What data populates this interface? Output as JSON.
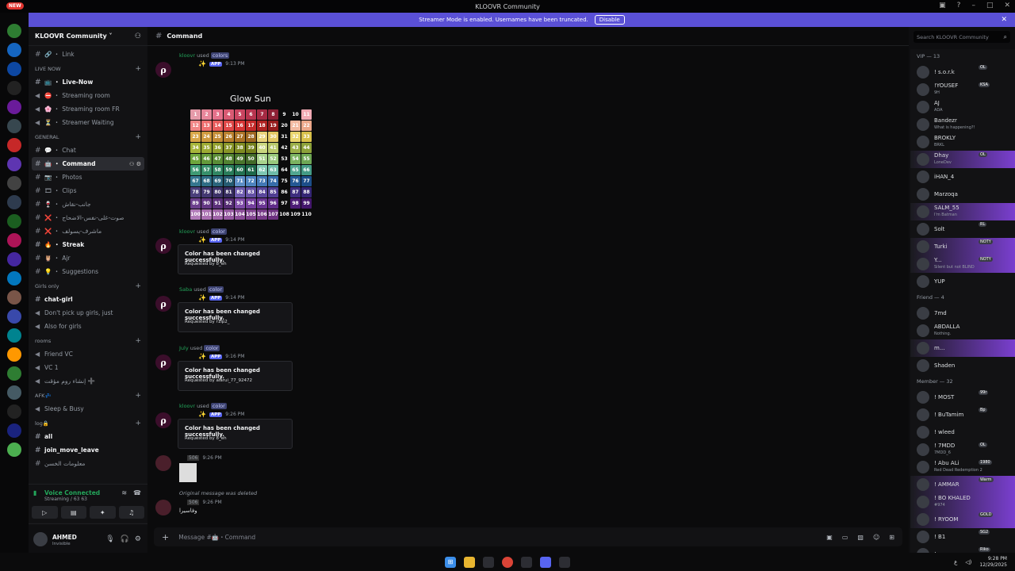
{
  "window": {
    "title": "KLOOVR Community",
    "new_badge": "NEW"
  },
  "banner": {
    "text": "Streamer Mode is enabled. Usernames have been truncated.",
    "button": "Disable"
  },
  "server": {
    "name": "KLOOVR Community"
  },
  "channels": [
    {
      "type": "ch",
      "icon": "🔗",
      "label": "Link"
    },
    {
      "type": "cat",
      "label": "LIVE NOW"
    },
    {
      "type": "ch",
      "icon": "📺",
      "label": "Live-Now",
      "bold": true
    },
    {
      "type": "voice",
      "icon": "⛔",
      "label": "Streaming room"
    },
    {
      "type": "voice",
      "icon": "🌸",
      "label": "Streaming room FR"
    },
    {
      "type": "voice",
      "icon": "⏳",
      "label": "Streamer Waiting"
    },
    {
      "type": "cat",
      "label": "GENERAL"
    },
    {
      "type": "ch",
      "icon": "💬",
      "label": "Chat"
    },
    {
      "type": "ch",
      "icon": "🤖",
      "label": "Command",
      "active": true
    },
    {
      "type": "ch",
      "icon": "📷",
      "label": "Photos"
    },
    {
      "type": "ch",
      "icon": "🎞",
      "label": "Clips"
    },
    {
      "type": "ch",
      "icon": "🍷",
      "label": "جانب-نقاش"
    },
    {
      "type": "ch",
      "icon": "❌",
      "label": "صوت-غلى-نفس-الاضحاج"
    },
    {
      "type": "ch",
      "icon": "❌",
      "label": "ماشرف-يسولف"
    },
    {
      "type": "ch",
      "icon": "🔥",
      "label": "Streak",
      "bold": true
    },
    {
      "type": "ch",
      "icon": "🦉",
      "label": "Ajr"
    },
    {
      "type": "ch",
      "icon": "💡",
      "label": "Suggestions"
    },
    {
      "type": "cat",
      "label": "Girls only"
    },
    {
      "type": "ch",
      "icon": "",
      "label": "chat-girl",
      "bold": true
    },
    {
      "type": "voice",
      "icon": "",
      "label": "Don't pick up girls, just"
    },
    {
      "type": "voice",
      "icon": "",
      "label": "Also for girls"
    },
    {
      "type": "cat",
      "label": "rooms"
    },
    {
      "type": "voice",
      "icon": "",
      "label": "Friend VC"
    },
    {
      "type": "voice",
      "icon": "",
      "label": "VC 1"
    },
    {
      "type": "voice",
      "icon": "",
      "label": "إنشاء روم مؤقت ➕"
    },
    {
      "type": "cat",
      "label": "AFK💤"
    },
    {
      "type": "voice",
      "icon": "",
      "label": "Sleep & Busy"
    },
    {
      "type": "cat",
      "label": "log🔒"
    },
    {
      "type": "ch",
      "icon": "",
      "label": "all",
      "bold": true
    },
    {
      "type": "ch",
      "icon": "",
      "label": "join_move_leave",
      "bold": true
    },
    {
      "type": "ch",
      "icon": "",
      "label": "معلومات الخسن"
    }
  ],
  "voice_connected": {
    "title": "Voice Connected",
    "sub": "Streaming / 63 63"
  },
  "user": {
    "name": "AHMED",
    "status": "Invisible"
  },
  "header": {
    "channel": "Command",
    "search_placeholder": "Search KLOOVR Community"
  },
  "grid": {
    "title": "Glow Sun"
  },
  "messages": [
    {
      "user": "kloovr",
      "cmd": "colors",
      "time": "9:13 PM",
      "app": "APP"
    },
    {
      "user": "kloovr",
      "cmd": "color",
      "time": "9:14 PM",
      "app": "APP",
      "title": "Color has been changed successfully.",
      "footer": "Requested by 8_eh"
    },
    {
      "user": "Saba",
      "cmd": "color",
      "time": "9:14 PM",
      "app": "APP",
      "title": "Color has been changed successfully.",
      "footer": "Requested by r1ip2_"
    },
    {
      "user": "July",
      "cmd": "color",
      "time": "9:16 PM",
      "app": "APP",
      "title": "Color has been changed successfully.",
      "footer": "Requested by alarui_77_92472"
    },
    {
      "user": "kloovr",
      "cmd": "color",
      "time": "9:26 PM",
      "app": "APP",
      "title": "Color has been changed successfully.",
      "footer": "Requested by 8_eh"
    }
  ],
  "msg_506": {
    "tag": "506",
    "time": "9:26 PM"
  },
  "deleted": {
    "note": "Original message was deleted",
    "tag": "506",
    "time": "9:26 PM",
    "text": "وفاسيرا"
  },
  "composer": {
    "placeholder": "Message #🤖・Command"
  },
  "members": {
    "groups": [
      {
        "label": "VIP — 13",
        "items": [
          {
            "name": "! s.o.r.k",
            "badge": "OL"
          },
          {
            "name": "!YOUSEF",
            "badge": "KSA",
            "tag": "9H"
          },
          {
            "name": "AJ",
            "tag": "ADA"
          },
          {
            "name": "Bandezr",
            "tag": "What is happening?!"
          },
          {
            "name": "BROKLY",
            "tag": "BRKL"
          },
          {
            "name": "Dhay",
            "badge": "OL",
            "tag": "LoneDev",
            "hl": true
          },
          {
            "name": "iHAN_4"
          },
          {
            "name": "Marzoqa"
          },
          {
            "name": "SALM_55",
            "tag": "I'm Batman",
            "hl": true
          },
          {
            "name": "Solt",
            "badge": "RL"
          },
          {
            "name": "Turki",
            "badge": "NOTY",
            "hl": true
          },
          {
            "name": "Y...",
            "badge": "NOTY",
            "tag": "Silent but not BLIND",
            "hl": true
          },
          {
            "name": "YUP"
          }
        ]
      },
      {
        "label": "Friend — 4",
        "items": [
          {
            "name": "7md"
          },
          {
            "name": "ABDALLA",
            "tag": "Nothing."
          },
          {
            "name": "m...",
            "hl": true
          },
          {
            "name": "Shaden"
          }
        ]
      },
      {
        "label": "Member — 32",
        "items": [
          {
            "name": "! MOST",
            "badge": "99r"
          },
          {
            "name": "! BuTamim",
            "badge": "Bp"
          },
          {
            "name": "! wleed"
          },
          {
            "name": "! 7MDD",
            "badge": "OL",
            "tag": "7MDD_6"
          },
          {
            "name": "! Abu ALi",
            "badge": "1980",
            "tag": "Red Dead Redemption 2"
          },
          {
            "name": "! AMMAR",
            "badge": "Warm",
            "hl": true
          },
          {
            "name": "! BO KHALED",
            "tag": "#974",
            "hl": true
          },
          {
            "name": "! RYOOM",
            "badge": "GOLD",
            "hl": true
          },
          {
            "name": "! B1",
            "badge": "SG2"
          },
          {
            "name": "!",
            "badge": "Riko"
          }
        ]
      }
    ]
  },
  "taskbar": {
    "time": "9:28 PM",
    "date": "12/29/2025",
    "lang": "ع"
  }
}
